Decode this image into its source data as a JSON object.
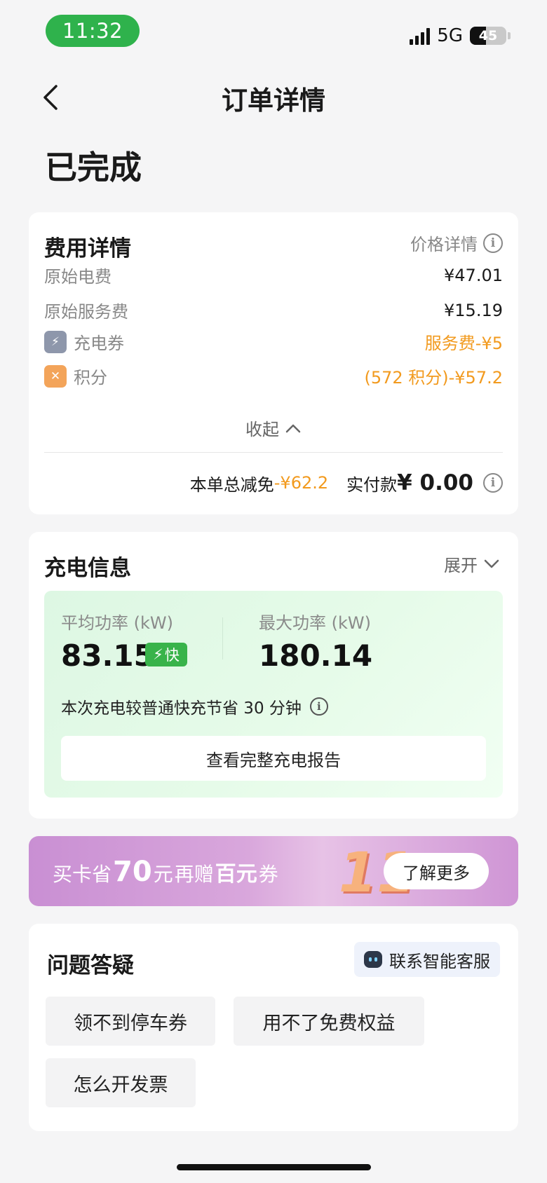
{
  "status_bar": {
    "time": "11:32",
    "network": "5G",
    "battery": "45"
  },
  "nav": {
    "title": "订单详情"
  },
  "order_status": "已完成",
  "fee_detail": {
    "title": "费用详情",
    "price_link": "价格详情",
    "rows": [
      {
        "label": "原始电费",
        "value": "¥47.01"
      },
      {
        "label": "原始服务费",
        "value": "¥15.19"
      },
      {
        "label": "充电券",
        "value": "服务费-¥5"
      },
      {
        "label": "积分",
        "value": "(572 积分)-¥57.2"
      }
    ],
    "collapse_label": "收起",
    "total_discount_label": "本单总减免",
    "total_discount_value": "-¥62.2",
    "paid_label": "实付款",
    "paid_value": "¥ 0.00"
  },
  "charge_info": {
    "title": "充电信息",
    "expand_label": "展开",
    "avg_power_label": "平均功率 (kW)",
    "avg_power_value": "83.15",
    "fast_badge": "快",
    "max_power_label": "最大功率 (kW)",
    "max_power_value": "180.14",
    "saving_text": "本次充电较普通快充节省 30 分钟",
    "report_button": "查看完整充电报告"
  },
  "banner": {
    "prefix": "买卡省",
    "amount": "70",
    "unit": "元",
    "middle": " 再赠",
    "highlight": "百元",
    "suffix": "券",
    "big_number": "11",
    "button": "了解更多"
  },
  "faq": {
    "title": "问题答疑",
    "cs_button": "联系智能客服",
    "chips": [
      "领不到停车券",
      "用不了免费权益",
      "怎么开发票"
    ]
  },
  "colors": {
    "accent_orange": "#f29a1e",
    "status_green": "#2fb24c",
    "fast_green": "#38b34a",
    "banner_purple": "#c98fd3"
  }
}
